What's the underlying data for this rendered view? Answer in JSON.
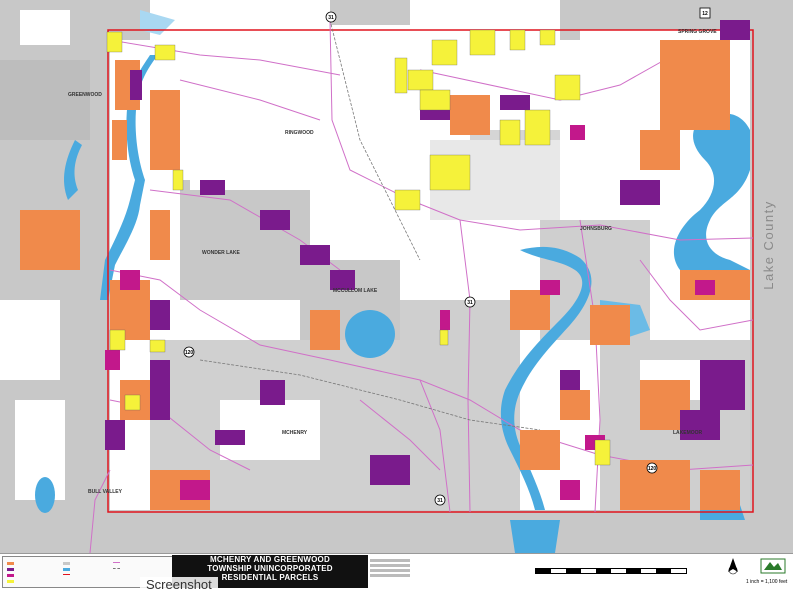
{
  "map": {
    "county_label": "Lake County",
    "places": [
      {
        "id": "greenwood",
        "name": "GREENWOOD"
      },
      {
        "id": "ringwood",
        "name": "RINGWOOD"
      },
      {
        "id": "spring-grove",
        "name": "SPRING GROVE"
      },
      {
        "id": "johnsburg",
        "name": "JOHNSBURG"
      },
      {
        "id": "wonder-lake",
        "name": "WONDER LAKE"
      },
      {
        "id": "mccullom-lake",
        "name": "MCCULLOM LAKE"
      },
      {
        "id": "mchenry",
        "name": "MCHENRY"
      },
      {
        "id": "lakemoor",
        "name": "LAKEMOOR"
      },
      {
        "id": "bull-valley",
        "name": "BULL VALLEY"
      }
    ],
    "routes": [
      "31",
      "31",
      "31",
      "120",
      "120",
      "12"
    ],
    "colors": {
      "boundary": "#e0141e",
      "water": "#4aaadf",
      "residential_orange": "#f08a4b",
      "residential_purple": "#7a1b8c",
      "residential_magenta": "#c2188b",
      "vacant_yellow": "#f5f23a",
      "urban_gray": "#c8c8c8",
      "roads": "#d070c8"
    }
  },
  "footer": {
    "title_line1": "MCHENRY AND GREENWOOD",
    "title_line2": "TOWNSHIP UNINCORPORATED",
    "title_line3": "RESIDENTIAL PARCELS",
    "scale_text": "1 inch = 1,100 feet",
    "watermark": "Screenshot"
  }
}
